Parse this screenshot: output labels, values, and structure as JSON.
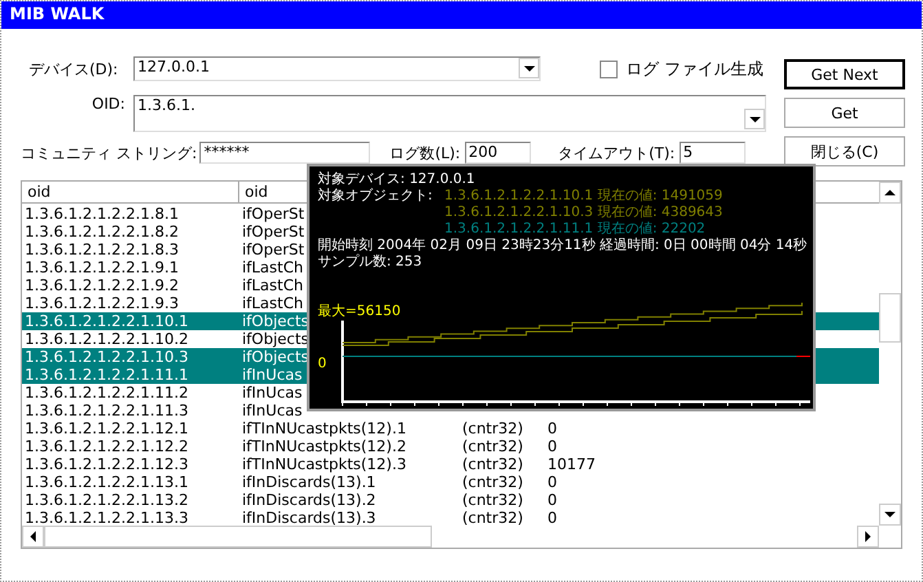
{
  "window": {
    "title": "MIB WALK"
  },
  "form": {
    "device_label": "デバイス(D):",
    "device_value": "127.0.0.1",
    "log_file": {
      "label": "ログ ファイル生成",
      "checked": false
    },
    "oid_label": "OID:",
    "oid_value": "1.3.6.1.",
    "community_label": "コミュニティ ストリング:",
    "community_value": "******",
    "log_count_label": "ログ数(L):",
    "log_count_value": "200",
    "timeout_label": "タイムアウト(T):",
    "timeout_value": "5"
  },
  "buttons": [
    {
      "label": "Get Next",
      "default": true
    },
    {
      "label": "Get",
      "default": false
    },
    {
      "label": "閉じる(C)",
      "default": false
    }
  ],
  "table": {
    "columns": [
      "oid",
      "oid"
    ],
    "rows": [
      {
        "cells": [
          "1.3.6.1.2.1.2.2.1.8.1",
          "ifOperSt"
        ],
        "selected": false
      },
      {
        "cells": [
          "1.3.6.1.2.1.2.2.1.8.2",
          "ifOperSt"
        ],
        "selected": false
      },
      {
        "cells": [
          "1.3.6.1.2.1.2.2.1.8.3",
          "ifOperSt"
        ],
        "selected": false
      },
      {
        "cells": [
          "1.3.6.1.2.1.2.2.1.9.1",
          "ifLastCh"
        ],
        "selected": false
      },
      {
        "cells": [
          "1.3.6.1.2.1.2.2.1.9.2",
          "ifLastCh"
        ],
        "selected": false
      },
      {
        "cells": [
          "1.3.6.1.2.1.2.2.1.9.3",
          "ifLastCh"
        ],
        "selected": false
      },
      {
        "cells": [
          "1.3.6.1.2.1.2.2.1.10.1",
          "ifObjects"
        ],
        "selected": true
      },
      {
        "cells": [
          "1.3.6.1.2.1.2.2.1.10.2",
          "ifObjects"
        ],
        "selected": false
      },
      {
        "cells": [
          "1.3.6.1.2.1.2.2.1.10.3",
          "ifObjects"
        ],
        "selected": true
      },
      {
        "cells": [
          "1.3.6.1.2.1.2.2.1.11.1",
          "ifInUcas"
        ],
        "selected": true
      },
      {
        "cells": [
          "1.3.6.1.2.1.2.2.1.11.2",
          "ifInUcas"
        ],
        "selected": false
      },
      {
        "cells": [
          "1.3.6.1.2.1.2.2.1.11.3",
          "ifInUcas"
        ],
        "selected": false
      },
      {
        "cells": [
          "1.3.6.1.2.1.2.2.1.12.1",
          "ifTInNUcastpkts(12).1",
          "(cntr32)",
          "0"
        ],
        "selected": false
      },
      {
        "cells": [
          "1.3.6.1.2.1.2.2.1.12.2",
          "ifTInNUcastpkts(12).2",
          "(cntr32)",
          "0"
        ],
        "selected": false
      },
      {
        "cells": [
          "1.3.6.1.2.1.2.2.1.12.3",
          "ifTInNUcastpkts(12).3",
          "(cntr32)",
          "10177"
        ],
        "selected": false
      },
      {
        "cells": [
          "1.3.6.1.2.1.2.2.1.13.1",
          "ifInDiscards(13).1",
          "(cntr32)",
          "0"
        ],
        "selected": false
      },
      {
        "cells": [
          "1.3.6.1.2.1.2.2.1.13.2",
          "ifInDiscards(13).2",
          "(cntr32)",
          "0"
        ],
        "selected": false
      },
      {
        "cells": [
          "1.3.6.1.2.1.2.2.1.13.3",
          "ifInDiscards(13).3",
          "(cntr32)",
          "0"
        ],
        "selected": false
      }
    ]
  },
  "popup": {
    "device_label": "対象デバイス:",
    "device": "127.0.0.1",
    "objects_label": "対象オブジェクト:",
    "objects": [
      {
        "oid": "1.3.6.1.2.1.2.2.1.10.1",
        "value_label": "現在の値:",
        "value": "1491059",
        "color": "#808000"
      },
      {
        "oid": "1.3.6.1.2.1.2.2.1.10.3",
        "value_label": "現在の値:",
        "value": "4389643",
        "color": "#808000"
      },
      {
        "oid": "1.3.6.1.2.1.2.2.1.11.1",
        "value_label": "現在の値:",
        "value": "22202",
        "color": "#008080"
      }
    ],
    "time_line": "開始時刻 2004年 02月 09日 23時23分11秒 経過時間: 0日 00時間 04分 14秒",
    "samples": "サンプル数: 253",
    "max_label": "最大=56150",
    "zero_label": "0"
  }
}
